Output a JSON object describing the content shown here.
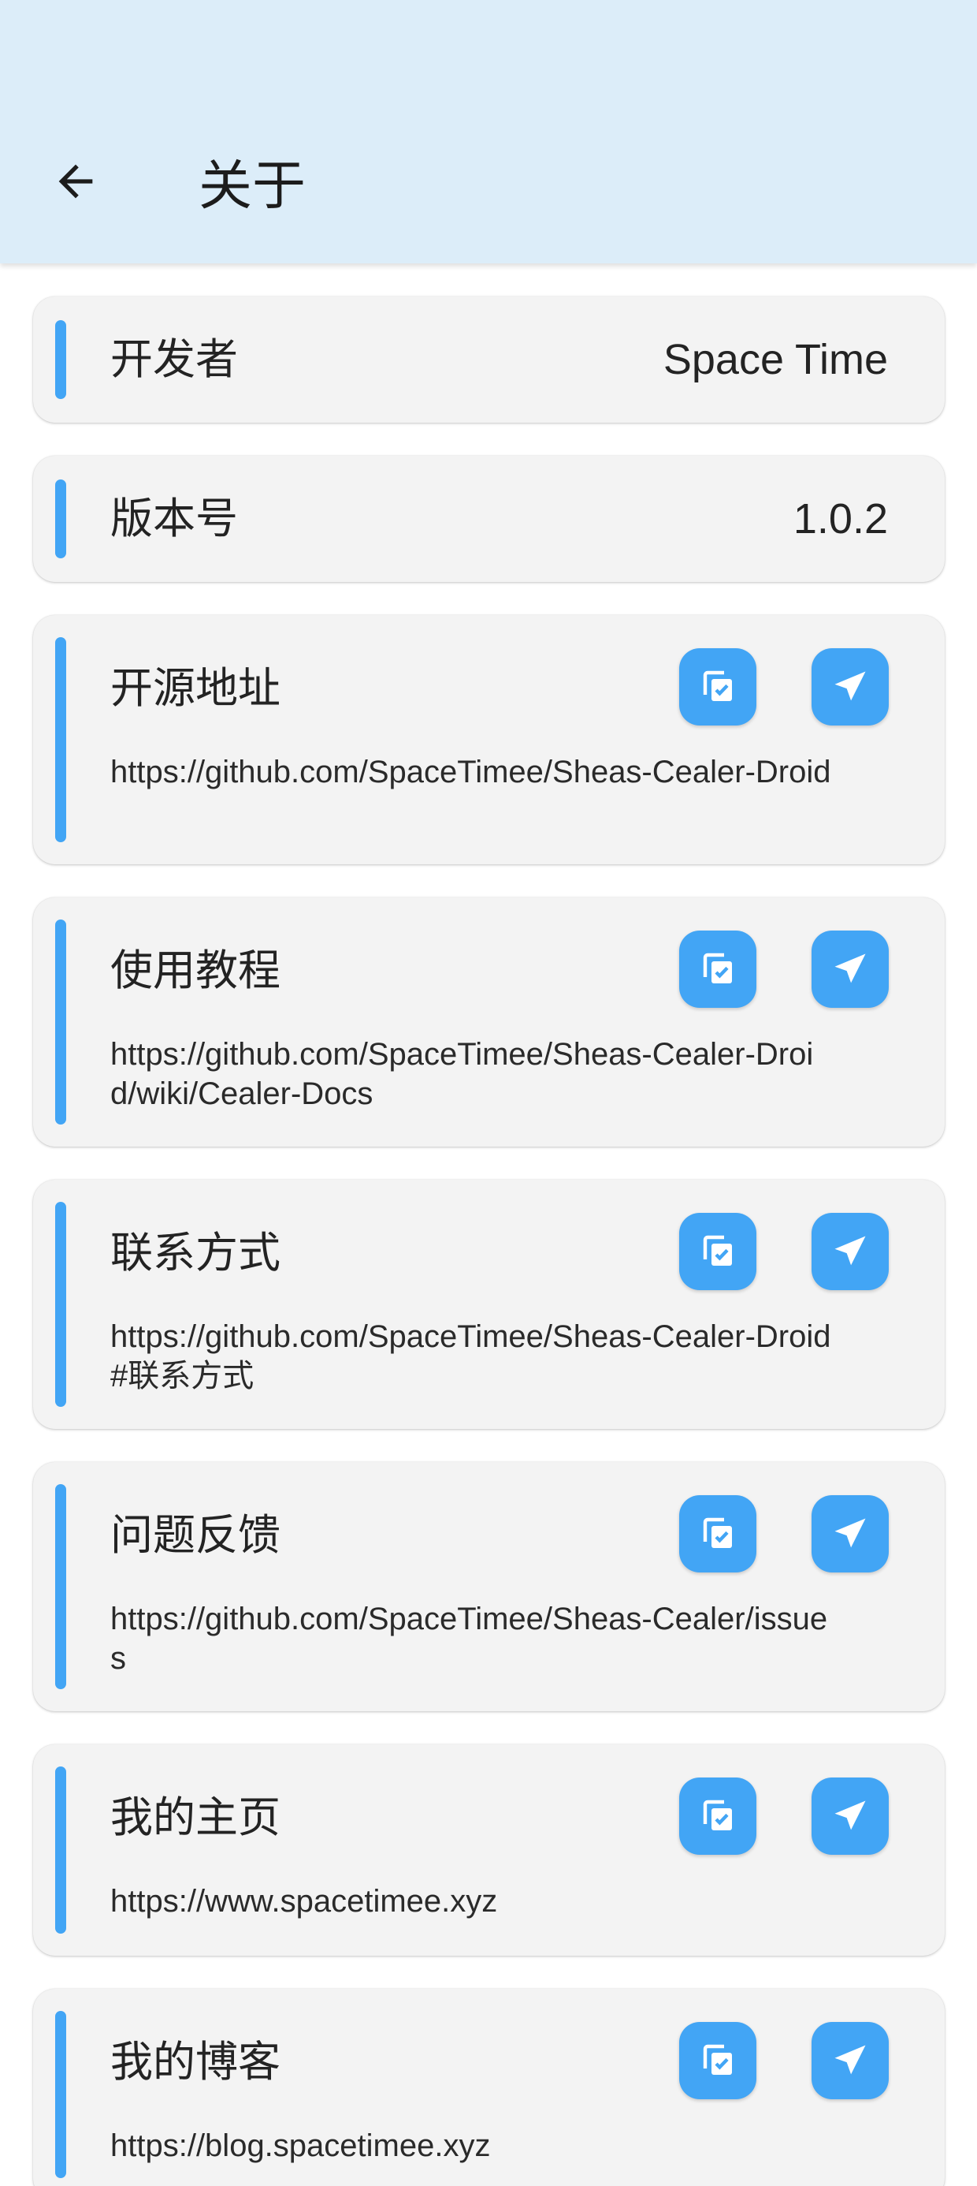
{
  "appbar": {
    "title": "关于",
    "back_icon": "arrow-back-icon"
  },
  "colors": {
    "appbar_bg": "#dcedf9",
    "card_bg": "#f3f3f3",
    "accent": "#42a5f5"
  },
  "info_rows": [
    {
      "label": "开发者",
      "value": "Space Time"
    },
    {
      "label": "版本号",
      "value": "1.0.2"
    }
  ],
  "link_rows": [
    {
      "label": "开源地址",
      "url": "https://github.com/SpaceTimee/Sheas-Cealer-Droid"
    },
    {
      "label": "使用教程",
      "url": "https://github.com/SpaceTimee/Sheas-Cealer-Droid/wiki/Cealer-Docs"
    },
    {
      "label": "联系方式",
      "url": "https://github.com/SpaceTimee/Sheas-Cealer-Droid#联系方式"
    },
    {
      "label": "问题反馈",
      "url": "https://github.com/SpaceTimee/Sheas-Cealer/issues"
    },
    {
      "label": "我的主页",
      "url": "https://www.spacetimee.xyz"
    },
    {
      "label": "我的博客",
      "url": "https://blog.spacetimee.xyz"
    }
  ],
  "icons": {
    "copy": "copy-icon",
    "open": "send-icon"
  }
}
